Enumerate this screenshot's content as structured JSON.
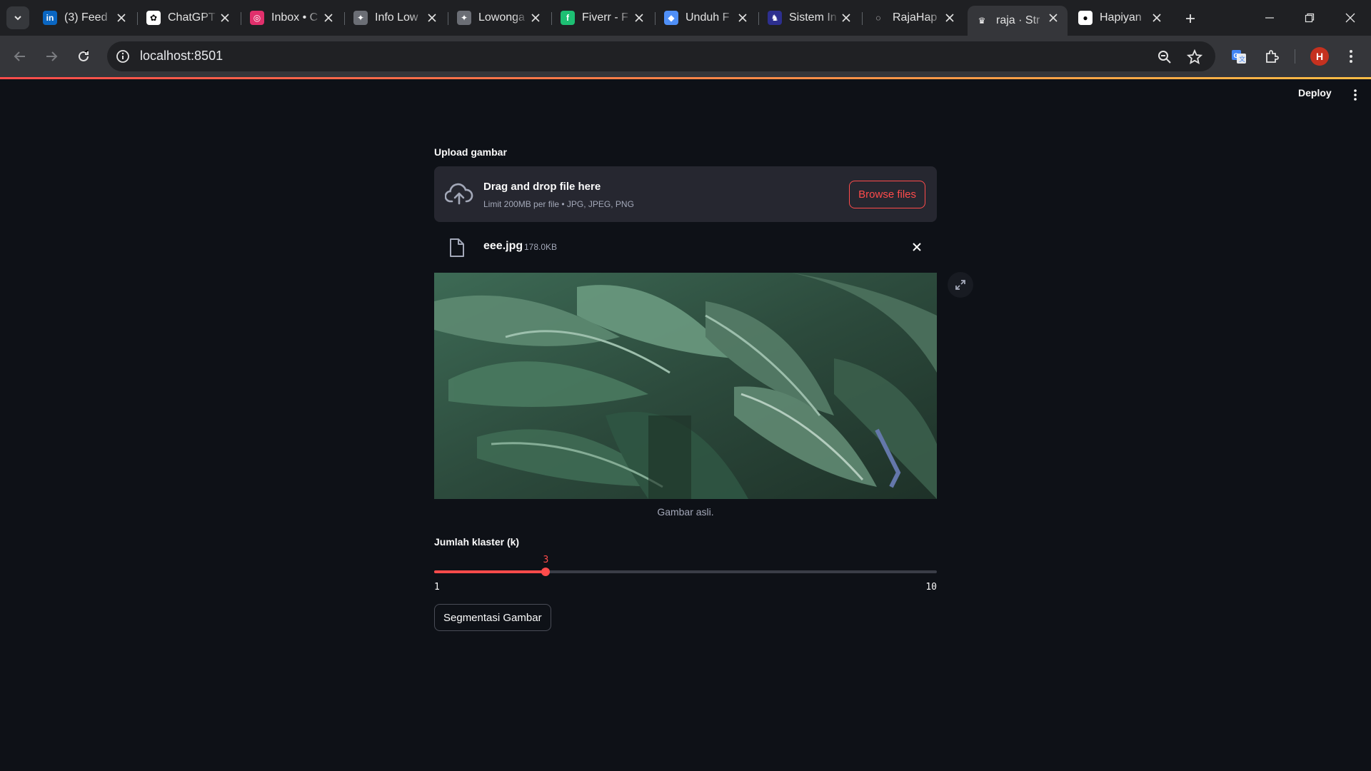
{
  "browser": {
    "tabs": [
      {
        "label": "(3) Feed",
        "icon": "linkedin-icon",
        "color": "#0a66c2",
        "glyph": "in"
      },
      {
        "label": "ChatGPT",
        "icon": "chatgpt-icon",
        "color": "#ffffff",
        "glyph": "✿"
      },
      {
        "label": "Inbox • C",
        "icon": "instagram-icon",
        "color": "#e1306c",
        "glyph": "◎"
      },
      {
        "label": "Info Low",
        "icon": "info-loker-icon",
        "color": "#6b6e75",
        "glyph": "✦"
      },
      {
        "label": "Lowonga",
        "icon": "lowongan-icon",
        "color": "#6b6e75",
        "glyph": "✦"
      },
      {
        "label": "Fiverr - F",
        "icon": "fiverr-icon",
        "color": "#1dbf73",
        "glyph": "f"
      },
      {
        "label": "Unduh F",
        "icon": "diamond-icon",
        "color": "#4f8ff7",
        "glyph": "◆"
      },
      {
        "label": "Sistem In",
        "icon": "sistem-icon",
        "color": "#2d2f8f",
        "glyph": "♞"
      },
      {
        "label": "RajaHap",
        "icon": "loading-spinner-icon",
        "color": "#1f2023",
        "glyph": "◌"
      },
      {
        "label": "raja · Str",
        "icon": "streamlit-crown-icon",
        "color": "#35363a",
        "glyph": "♛",
        "active": true
      },
      {
        "label": "Hapiyan",
        "icon": "github-icon",
        "color": "#ffffff",
        "glyph": "●"
      }
    ],
    "url": "localhost:8501"
  },
  "header": {
    "deploy_label": "Deploy"
  },
  "uploader": {
    "label": "Upload gambar",
    "drop_title": "Drag and drop file here",
    "drop_sub": "Limit 200MB per file • JPG, JPEG, PNG",
    "browse_label": "Browse files"
  },
  "file": {
    "name": "eee.jpg",
    "size": "178.0KB"
  },
  "image": {
    "caption": "Gambar asli."
  },
  "slider": {
    "label": "Jumlah klaster (k)",
    "min": 1,
    "max": 10,
    "value": 3
  },
  "action": {
    "segment_label": "Segmentasi Gambar"
  },
  "colors": {
    "accent": "#ff4b4b",
    "background": "#0e1117",
    "secondary_bg": "#262730"
  }
}
